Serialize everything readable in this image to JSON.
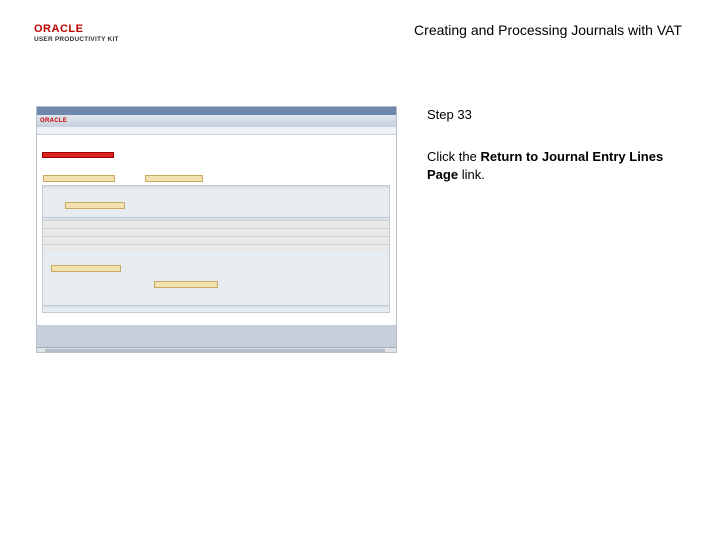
{
  "header": {
    "logo_brand": "ORACLE",
    "logo_subtitle": "USER PRODUCTIVITY KIT",
    "title": "Creating and Processing Journals with VAT"
  },
  "step": {
    "number": "Step 33",
    "instruction_prefix": "Click the ",
    "instruction_link": "Return to Journal Entry Lines Page",
    "instruction_suffix": " link."
  },
  "screenshot": {
    "brand": "ORACLE",
    "colors": {
      "accent": "#6d88ac",
      "link_highlight": "#d22222"
    }
  }
}
